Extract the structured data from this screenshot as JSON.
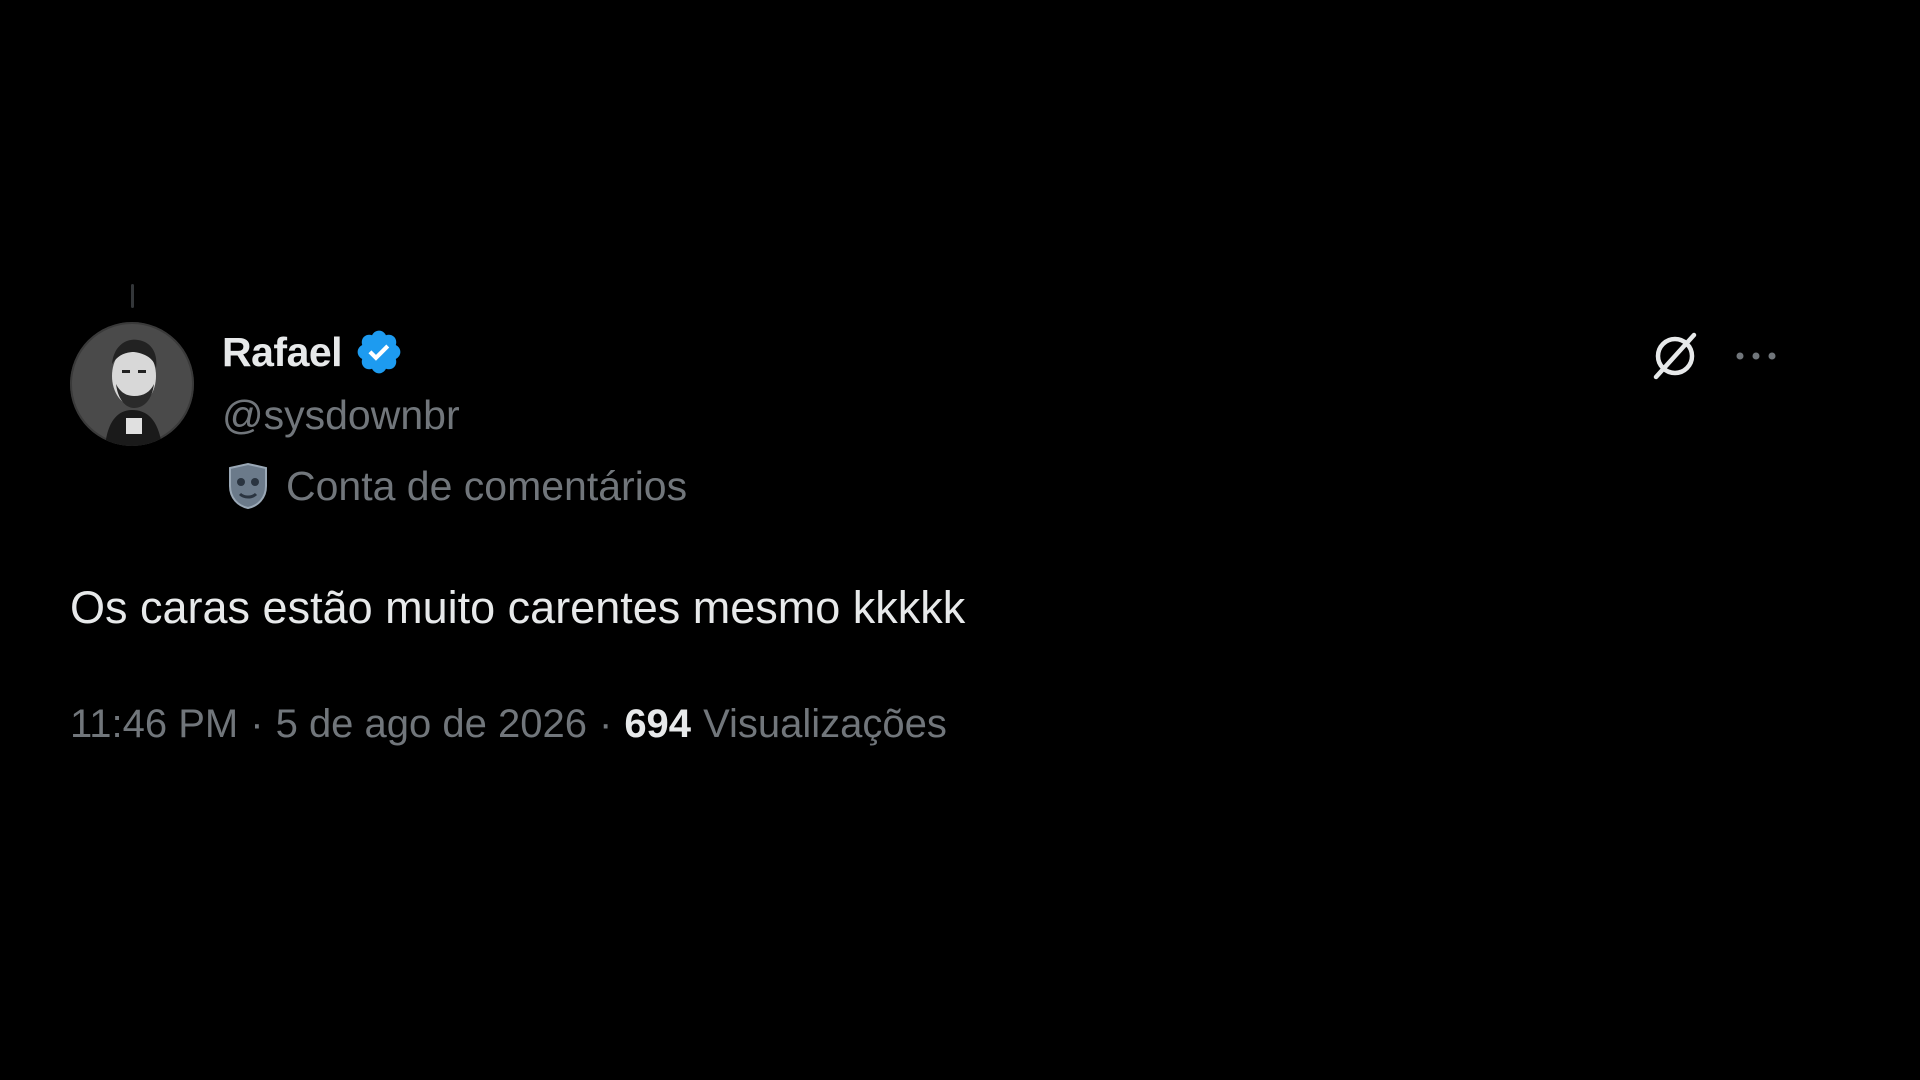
{
  "tweet": {
    "author": {
      "display_name": "Rafael",
      "handle": "@sysdownbr",
      "verified": true,
      "label": "Conta de comentários",
      "avatar_icon": "avatar-photo"
    },
    "text": "Os caras estão muito carentes mesmo kkkkk",
    "time": "11:46 PM",
    "date": "5 de ago de 2026",
    "separator": "·",
    "views_count": "694",
    "views_label": "Visualizações"
  },
  "actions": {
    "grok_icon": "grok-icon",
    "more_icon": "more-icon"
  },
  "colors": {
    "background": "#000000",
    "primary_text": "#e7e9ea",
    "secondary_text": "#71767b",
    "verified_blue": "#1d9bf0"
  }
}
